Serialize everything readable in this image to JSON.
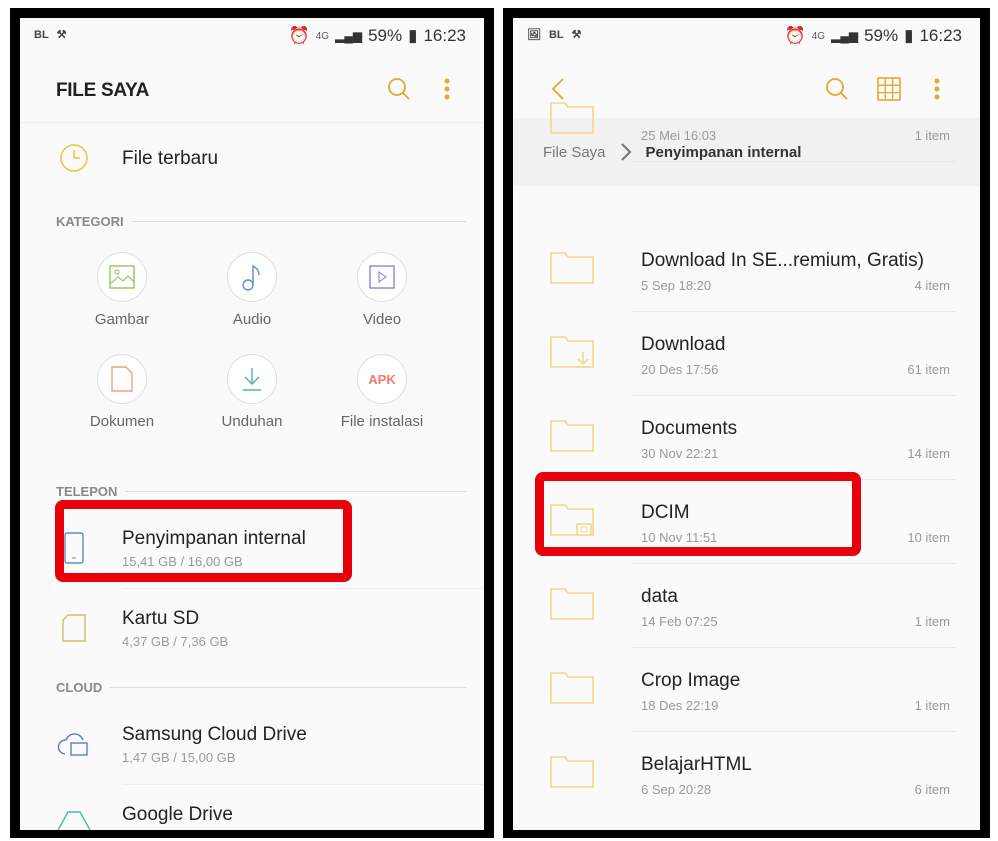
{
  "status_bar": {
    "left_icons": [
      "BL",
      "notification-icon"
    ],
    "battery": "59%",
    "time": "16:23",
    "network": "4G"
  },
  "left_screen": {
    "title": "FILE SAYA",
    "recent": "File terbaru",
    "category_header": "KATEGORI",
    "categories": [
      {
        "label": "Gambar",
        "icon": "image-icon",
        "color": "#8bc34a"
      },
      {
        "label": "Audio",
        "icon": "music-note-icon",
        "color": "#5b8fc7"
      },
      {
        "label": "Video",
        "icon": "video-icon",
        "color": "#8a7ad6"
      },
      {
        "label": "Dokumen",
        "icon": "document-icon",
        "color": "#f0a27a"
      },
      {
        "label": "Unduhan",
        "icon": "download-icon",
        "color": "#4fb6a3"
      },
      {
        "label": "File instalasi",
        "icon": "apk-icon",
        "color": "#f07a6a",
        "text": "APK"
      }
    ],
    "phone_header": "TELEPON",
    "storage": [
      {
        "name": "Penyimpanan internal",
        "size": "15,41 GB / 16,00 GB"
      },
      {
        "name": "Kartu SD",
        "size": "4,37 GB / 7,36 GB"
      }
    ],
    "cloud_header": "CLOUD",
    "cloud": [
      {
        "name": "Samsung Cloud Drive",
        "size": "1,47 GB / 15,00 GB"
      },
      {
        "name": "Google Drive"
      }
    ]
  },
  "right_screen": {
    "breadcrumb": [
      "File Saya",
      "Penyimpanan internal"
    ],
    "folders": [
      {
        "name": "",
        "date": "25 Mei 16:03",
        "count": "1 item"
      },
      {
        "name": "Download In SE...remium, Gratis)",
        "date": "5 Sep 18:20",
        "count": "4 item"
      },
      {
        "name": "Download",
        "date": "20 Des 17:56",
        "count": "61 item"
      },
      {
        "name": "Documents",
        "date": "30 Nov 22:21",
        "count": "14 item"
      },
      {
        "name": "DCIM",
        "date": "10 Nov 11:51",
        "count": "10 item"
      },
      {
        "name": "data",
        "date": "14 Feb 07:25",
        "count": "1 item"
      },
      {
        "name": "Crop Image",
        "date": "18 Des 22:19",
        "count": "1 item"
      },
      {
        "name": "BelajarHTML",
        "date": "6 Sep 20:28",
        "count": "6 item"
      }
    ]
  },
  "colors": {
    "accent": "#e3a92b",
    "highlight": "#e8000b",
    "folder": "#f2d68b"
  }
}
